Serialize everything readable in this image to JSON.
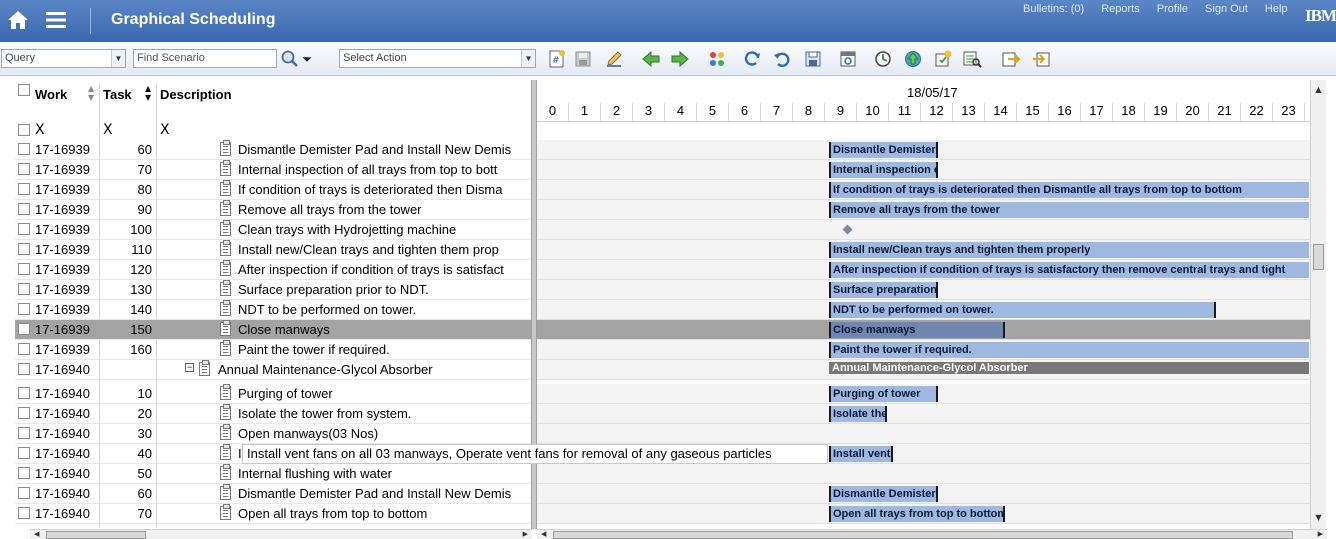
{
  "header": {
    "title": "Graphical Scheduling",
    "links": [
      "Bulletins: (0)",
      "Reports",
      "Profile",
      "Sign Out",
      "Help"
    ],
    "logo": "IBM"
  },
  "toolbar": {
    "query_value": "Query",
    "scenario_placeholder": "Find Scenario",
    "action_value": "Select Action"
  },
  "grid": {
    "columns": {
      "work": "Work",
      "task": "Task",
      "description": "Description"
    },
    "filter_marks": [
      "X",
      "X",
      "X"
    ],
    "rows": [
      {
        "work": "17-16939",
        "task": "60",
        "desc": "Dismantle Demister Pad and Install New Demis",
        "indent": 1
      },
      {
        "work": "17-16939",
        "task": "70",
        "desc": "Internal inspection of all trays from top to bott",
        "indent": 1
      },
      {
        "work": "17-16939",
        "task": "80",
        "desc": "If condition of trays is deteriorated then Disma",
        "indent": 1
      },
      {
        "work": "17-16939",
        "task": "90",
        "desc": "Remove all trays from the tower",
        "indent": 1
      },
      {
        "work": "17-16939",
        "task": "100",
        "desc": "Clean trays with Hydrojetting machine",
        "indent": 1
      },
      {
        "work": "17-16939",
        "task": "110",
        "desc": "Install new/Clean trays and tighten them prop",
        "indent": 1
      },
      {
        "work": "17-16939",
        "task": "120",
        "desc": "After inspection if condition of trays is satisfact",
        "indent": 1
      },
      {
        "work": "17-16939",
        "task": "130",
        "desc": "Surface preparation prior to NDT.",
        "indent": 1
      },
      {
        "work": "17-16939",
        "task": "140",
        "desc": "NDT to be performed on tower.",
        "indent": 1
      },
      {
        "work": "17-16939",
        "task": "150",
        "desc": "Close manways",
        "indent": 1,
        "selected": true
      },
      {
        "work": "17-16939",
        "task": "160",
        "desc": "Paint the tower if required.",
        "indent": 1
      },
      {
        "work": "17-16940",
        "task": "",
        "desc": "Annual Maintenance-Glycol Absorber",
        "indent": 0,
        "parent": true
      },
      {
        "work": "17-16940",
        "task": "10",
        "desc": "Purging of tower",
        "indent": 1
      },
      {
        "work": "17-16940",
        "task": "20",
        "desc": "Isolate the tower from system.",
        "indent": 1
      },
      {
        "work": "17-16940",
        "task": "30",
        "desc": "Open manways(03 Nos)",
        "indent": 1
      },
      {
        "work": "17-16940",
        "task": "40",
        "desc": "I",
        "indent": 1
      },
      {
        "work": "17-16940",
        "task": "50",
        "desc": "Internal flushing with water",
        "indent": 1
      },
      {
        "work": "17-16940",
        "task": "60",
        "desc": "Dismantle Demister Pad and Install New Demis",
        "indent": 1
      },
      {
        "work": "17-16940",
        "task": "70",
        "desc": "Open all trays from top to bottom",
        "indent": 1
      }
    ]
  },
  "tooltip": "Install vent fans on all 03 manways, Operate vent fans for removal of any gaseous particles",
  "gantt": {
    "date": "18/05/17",
    "hours": [
      "0",
      "1",
      "2",
      "3",
      "4",
      "5",
      "6",
      "7",
      "8",
      "9",
      "10",
      "11",
      "12",
      "13",
      "14",
      "15",
      "16",
      "17",
      "18",
      "19",
      "20",
      "21",
      "22",
      "23"
    ],
    "bars": [
      {
        "label": "Dismantle Demister P",
        "start": 9.0,
        "end": 12.4
      },
      {
        "label": "Internal inspection of all trays fro",
        "start": 9.0,
        "end": 12.4
      },
      {
        "label": "If condition of trays is deteriorated then Dismantle all trays from top to bottom",
        "start": 9.0,
        "end": 24
      },
      {
        "label": "Remove all trays from the tower",
        "start": 9.0,
        "end": 24
      },
      {
        "label": "",
        "milestone": 8.5
      },
      {
        "label": "Install new/Clean trays and tighten them properly",
        "start": 9.0,
        "end": 24
      },
      {
        "label": "After inspection if condition of trays is satisfactory then remove central trays and tight",
        "start": 9.0,
        "end": 24
      },
      {
        "label": "Surface preparation p",
        "start": 9.0,
        "end": 12.4
      },
      {
        "label": "NDT to be performed on tower.",
        "start": 9.0,
        "end": 21.1
      },
      {
        "label": "Close manways",
        "start": 9.0,
        "end": 14.5,
        "dark": true
      },
      {
        "label": "Paint the tower if required.",
        "start": 9.0,
        "end": 24
      },
      {
        "label": "Annual Maintenance-Glycol Absorber",
        "start": 9.0,
        "end": 24,
        "summary": true
      },
      {
        "label": "Purging of tower",
        "start": 9.0,
        "end": 12.4
      },
      {
        "label": "Isolate the",
        "start": 9.0,
        "end": 10.8
      },
      {
        "label": "",
        "none": true
      },
      {
        "label": "Install vent fans",
        "start": 9.0,
        "end": 11.0
      },
      {
        "label": "",
        "none": true
      },
      {
        "label": "Dismantle Demister P",
        "start": 9.0,
        "end": 12.4
      },
      {
        "label": "Open all trays from top to bottom",
        "start": 9.0,
        "end": 14.5
      }
    ]
  }
}
